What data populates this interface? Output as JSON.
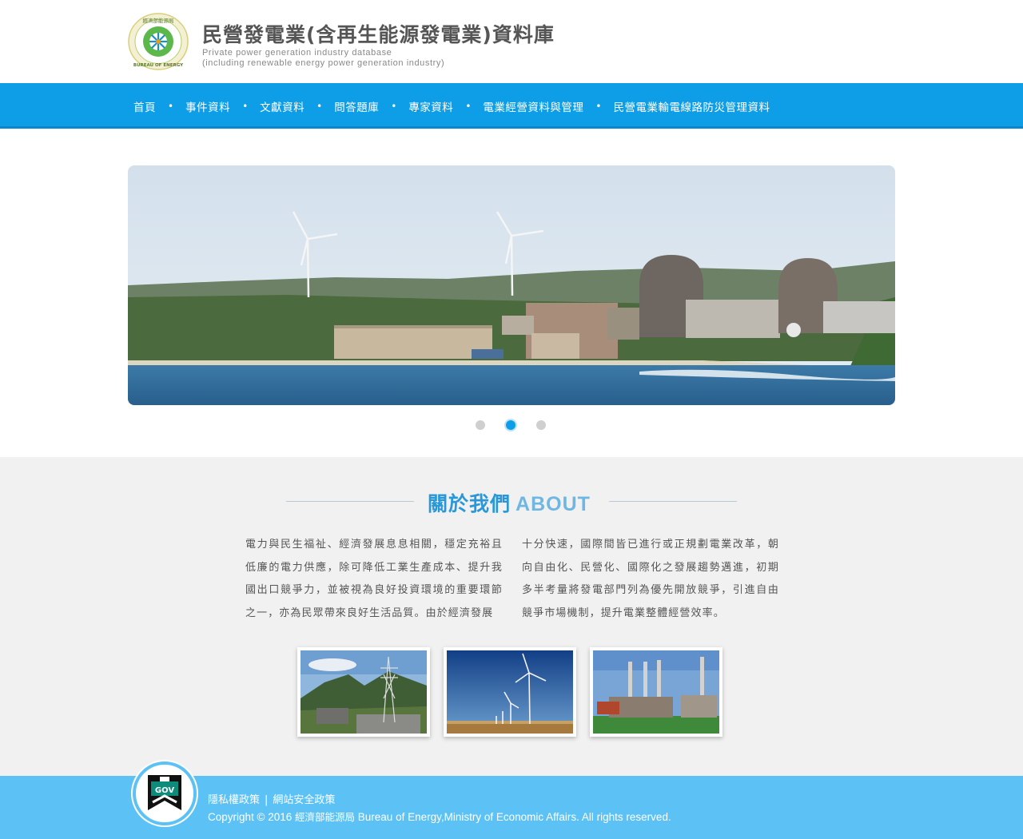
{
  "header": {
    "title": "民營發電業(含再生能源發電業)資料庫",
    "subtitle_line1": "Private power generation industry database",
    "subtitle_line2": "(including renewable energy power generation industry)",
    "logo_text_top": "經濟部能源局",
    "logo_text_bottom": "BUREAU OF ENERGY"
  },
  "nav": {
    "items": [
      {
        "label": "首頁"
      },
      {
        "label": "事件資料"
      },
      {
        "label": "文獻資料"
      },
      {
        "label": "問答題庫"
      },
      {
        "label": "專家資料"
      },
      {
        "label": "電業經營資料與管理"
      },
      {
        "label": "民營電業輸電線路防災管理資料"
      }
    ],
    "separator": "•"
  },
  "slider": {
    "slide_count": 3,
    "active_index": 1
  },
  "about": {
    "title_zh": "關於我們",
    "title_en": "ABOUT",
    "col1": "電力與民生福祉、經濟發展息息相關，穩定充裕且低廉的電力供應，除可降低工業生產成本、提升我國出口競爭力，並被視為良好投資環境的重要環節之一，亦為民眾帶來良好生活品質。由於經濟發展",
    "col2": "十分快速，國際間皆已進行或正規劃電業改革，朝向自由化、民營化、國際化之發展趨勢邁進，初期多半考量將發電部門列為優先開放競爭，引進自由競爭市場機制，提升電業整體經營效率。"
  },
  "footer": {
    "privacy_label": "隱私權政策",
    "security_label": "網站安全政策",
    "divider": "|",
    "copyright_prefix": "Copyright © 2016 ",
    "copyright_zh": "經濟部能源局",
    "copyright_suffix": " Bureau of Energy,Ministry of Economic Affairs. All rights reserved.",
    "gov_label": "GOV"
  },
  "colors": {
    "nav_blue": "#0e9ee8",
    "footer_blue": "#5cc2f5",
    "about_bg": "#f1f1f1",
    "accent": "#2a98d8"
  }
}
